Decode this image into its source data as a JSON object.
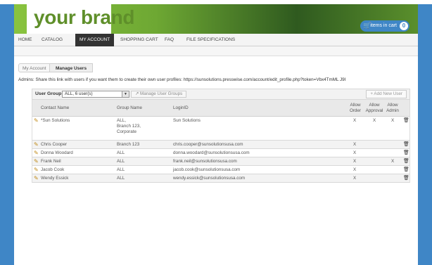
{
  "header": {
    "brand": "your brand",
    "cart_label": "items in cart",
    "cart_count": "0"
  },
  "nav": {
    "items": [
      "HOME",
      "CATALOG",
      "MY ACCOUNT",
      "SHOPPING CART",
      "FAQ",
      "FILE SPECIFICATIONS"
    ],
    "active": "MY ACCOUNT"
  },
  "breadcrumb": {
    "parent": "My Account",
    "current": "Manage Users"
  },
  "admins_note": "Admins: Share this link with users if you want them to create their own user profiles: https://sunsolutions.presswise.com/account/edit_profile.php?token=Vbx4TmML J9I",
  "toolbar": {
    "group_label": "User Group:",
    "group_value": "ALL, 6 user(s)",
    "manage_groups": "Manage User Groups",
    "add_user": "+ Add New User"
  },
  "table": {
    "headers": {
      "contact": "Contact Name",
      "group": "Group Name",
      "login": "LoginID",
      "allow_order_1": "Allow",
      "allow_order_2": "Order",
      "allow_approval_1": "Allow",
      "allow_approval_2": "Approval",
      "allow_admin_1": "Allow",
      "allow_admin_2": "Admin"
    },
    "rows": [
      {
        "contact": "*Sun Solutions",
        "group_lines": [
          "ALL,",
          "Branch 123,",
          "Corporate"
        ],
        "login": "Sun Solutions",
        "order": "X",
        "approval": "X",
        "admin": "X"
      },
      {
        "contact": "Chris Cooper",
        "group_lines": [
          "Branch 123"
        ],
        "login": "chris.cooper@sunsolutionsusa.com",
        "order": "X",
        "approval": "",
        "admin": ""
      },
      {
        "contact": "Donna Woodard",
        "group_lines": [
          "ALL"
        ],
        "login": "donna.woodard@sunsolutionsusa.com",
        "order": "X",
        "approval": "",
        "admin": ""
      },
      {
        "contact": "Frank Neil",
        "group_lines": [
          "ALL"
        ],
        "login": "frank.neil@sunsolutionsusa.com",
        "order": "X",
        "approval": "",
        "admin": "X"
      },
      {
        "contact": "Jacob Cook",
        "group_lines": [
          "ALL"
        ],
        "login": "jacob.cook@sunsolutionsusa.com",
        "order": "X",
        "approval": "",
        "admin": ""
      },
      {
        "contact": "Wendy Essick",
        "group_lines": [
          "ALL"
        ],
        "login": "wendy.essick@sunsolutionsusa.com",
        "order": "X",
        "approval": "",
        "admin": ""
      }
    ]
  }
}
